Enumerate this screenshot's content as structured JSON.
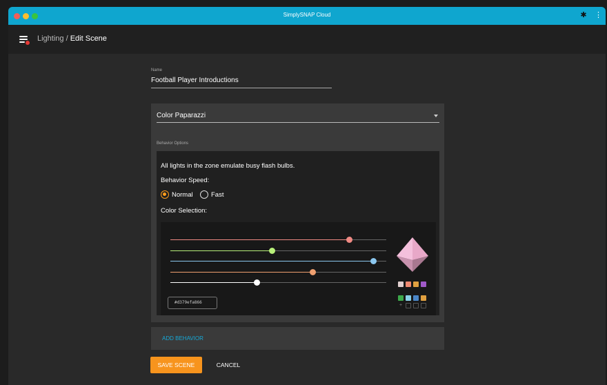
{
  "window": {
    "title": "SimplySNAP Cloud"
  },
  "breadcrumb": {
    "parent": "Lighting",
    "separator": " / ",
    "current": "Edit Scene"
  },
  "name_field": {
    "label": "Name",
    "value": "Football Player Introductions"
  },
  "behavior": {
    "selected": "Color Paparazzi",
    "options_label": "Behavior Options",
    "description": "All lights in the zone emulate busy flash bulbs.",
    "speed_label": "Behavior Speed:",
    "speed_options": [
      {
        "label": "Normal",
        "selected": true
      },
      {
        "label": "Fast",
        "selected": false
      }
    ],
    "color_label": "Color Selection:"
  },
  "color_picker": {
    "hex_value": "#d379efa866",
    "sliders": [
      {
        "name": "red",
        "color": "#f08a84",
        "level": 0.83
      },
      {
        "name": "green",
        "color": "#b8f07a",
        "level": 0.47
      },
      {
        "name": "blue",
        "color": "#8cc8f0",
        "level": 0.94
      },
      {
        "name": "amber",
        "color": "#f0a070",
        "level": 0.66
      },
      {
        "name": "white",
        "color": "#ffffff",
        "level": 0.4
      }
    ],
    "swatches_row1": [
      "#e0cfcf",
      "#f08a72",
      "#e0a040",
      "#a05ac8"
    ],
    "swatches_row2": [
      "#3ca84a",
      "#8ad0e8",
      "#4a86c8",
      "#e0a040"
    ]
  },
  "actions": {
    "add_behavior": "ADD BEHAVIOR",
    "save": "SAVE SCENE",
    "cancel": "CANCEL"
  },
  "colors": {
    "accent": "#f7941d",
    "link": "#16a9d8",
    "titlebar": "#0fa6cf"
  }
}
